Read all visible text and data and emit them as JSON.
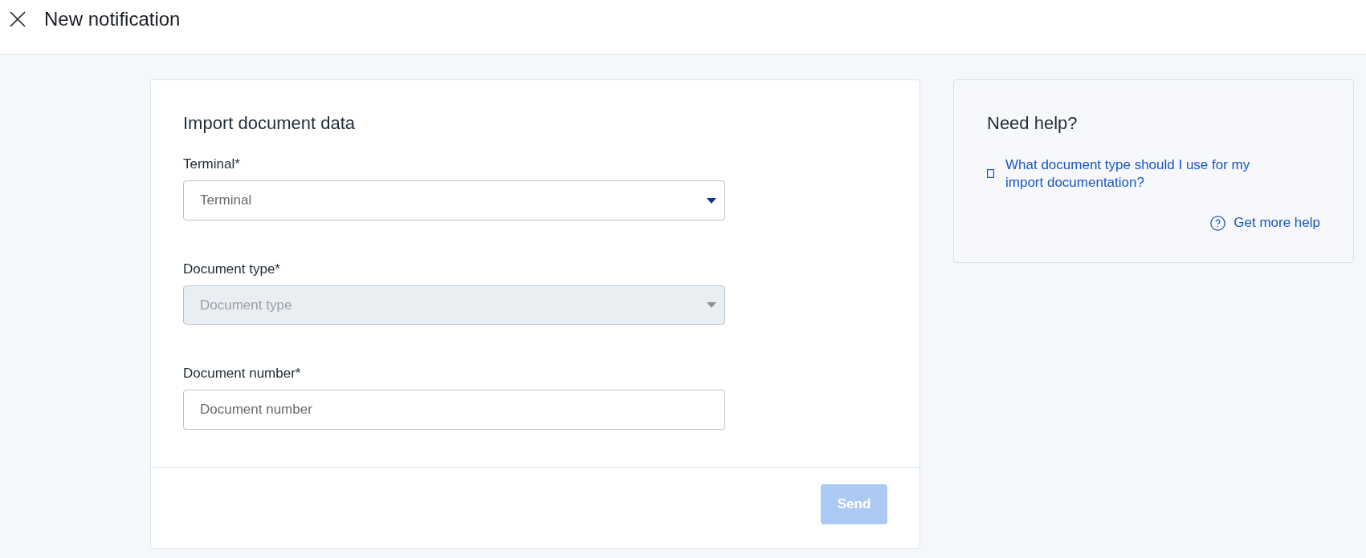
{
  "header": {
    "title": "New notification"
  },
  "form": {
    "title": "Import document data",
    "fields": [
      {
        "kind": "select",
        "label": "Terminal*",
        "placeholder": "Terminal",
        "disabled": false
      },
      {
        "kind": "select",
        "label": "Document type*",
        "placeholder": "Document type",
        "disabled": true
      },
      {
        "kind": "text",
        "label": "Document number*",
        "placeholder": "Document number",
        "disabled": false
      }
    ],
    "submit": {
      "label": "Send",
      "disabled": true
    }
  },
  "help": {
    "title": "Need help?",
    "links": [
      "What document type should I use for my import documentation?"
    ],
    "more_help": "Get more help"
  }
}
